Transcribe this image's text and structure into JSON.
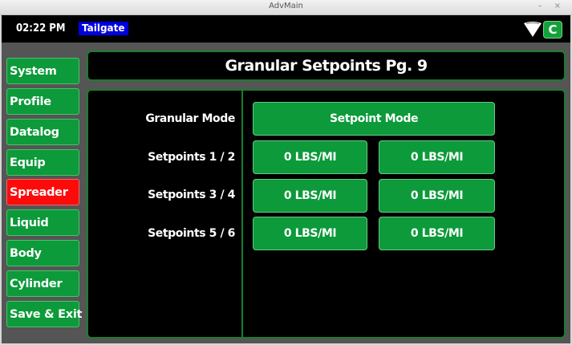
{
  "window": {
    "title": "AdvMain",
    "controls": "– ×"
  },
  "topbar": {
    "time": "02:22 PM",
    "tailgate_label": "Tailgate",
    "c_label": "C"
  },
  "nav": [
    {
      "label": "System"
    },
    {
      "label": "Profile"
    },
    {
      "label": "Datalog"
    },
    {
      "label": "Equip"
    },
    {
      "label": "Spreader",
      "active": true
    },
    {
      "label": "Liquid"
    },
    {
      "label": "Body"
    },
    {
      "label": "Cylinder"
    },
    {
      "label": "Save & Exit"
    }
  ],
  "page": {
    "title": "Granular Setpoints Pg. 9"
  },
  "settings": {
    "mode_label": "Granular Mode",
    "mode_value": "Setpoint Mode",
    "rows": [
      {
        "label": "Setpoints 1 / 2",
        "left": "0 LBS/MI",
        "right": "0 LBS/MI"
      },
      {
        "label": "Setpoints 3 / 4",
        "left": "0 LBS/MI",
        "right": "0 LBS/MI"
      },
      {
        "label": "Setpoints 5 / 6",
        "left": "0 LBS/MI",
        "right": "0 LBS/MI"
      }
    ]
  },
  "colors": {
    "accent_green": "#0c9a3a",
    "active_red": "#ff0a0a",
    "tailgate_blue": "#0000e0"
  }
}
